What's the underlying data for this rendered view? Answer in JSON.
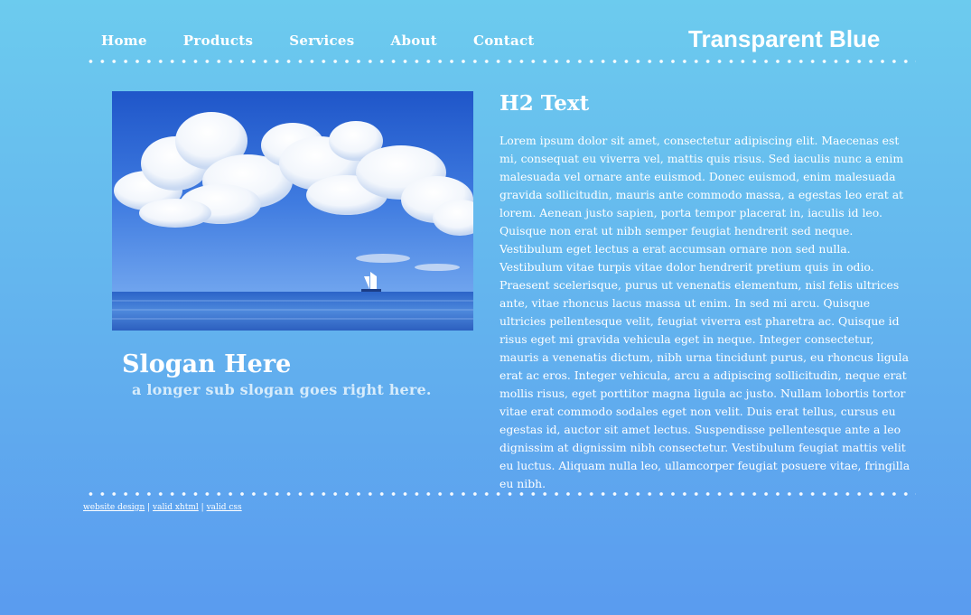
{
  "nav": {
    "items": [
      {
        "label": "Home"
      },
      {
        "label": "Products"
      },
      {
        "label": "Services"
      },
      {
        "label": "About"
      },
      {
        "label": "Contact"
      }
    ]
  },
  "brand": {
    "title": "Transparent Blue"
  },
  "content": {
    "heading": "H2 Text",
    "paragraph": "Lorem ipsum dolor sit amet, consectetur adipiscing elit. Maecenas est mi, consequat eu viverra vel, mattis quis risus. Sed iaculis nunc a enim malesuada vel ornare ante euismod. Donec euismod, enim malesuada gravida sollicitudin, mauris ante commodo massa, a egestas leo erat at lorem. Aenean justo sapien, porta tempor placerat in, iaculis id leo. Quisque non erat ut nibh semper feugiat hendrerit sed neque. Vestibulum eget lectus a erat accumsan ornare non sed nulla. Vestibulum vitae turpis vitae dolor hendrerit pretium quis in odio. Praesent scelerisque, purus ut venenatis elementum, nisl felis ultrices ante, vitae rhoncus lacus massa ut enim. In sed mi arcu. Quisque ultricies pellentesque velit, feugiat viverra est pharetra ac. Quisque id risus eget mi gravida vehicula eget in neque. Integer consectetur, mauris a venenatis dictum, nibh urna tincidunt purus, eu rhoncus ligula erat ac eros. Integer vehicula, arcu a adipiscing sollicitudin, neque erat mollis risus, eget porttitor magna ligula ac justo. Nullam lobortis tortor vitae erat commodo sodales eget non velit. Duis erat tellus, cursus eu egestas id, auctor sit amet lectus. Suspendisse pellentesque ante a leo dignissim at dignissim nibh consectetur. Vestibulum feugiat mattis velit eu luctus. Aliquam nulla leo, ullamcorper feugiat posuere vitae, fringilla eu nibh."
  },
  "slogan": {
    "title": "Slogan Here",
    "subtitle": "a longer sub slogan goes right here."
  },
  "footer": {
    "links": [
      {
        "label": "website design"
      },
      {
        "label": "valid xhtml"
      },
      {
        "label": "valid css"
      }
    ],
    "separator": "|"
  },
  "colors": {
    "background_top": "#6ccbee",
    "background_bottom": "#5a9bef",
    "text": "#ffffff",
    "subslogan": "#d7ecfb"
  }
}
